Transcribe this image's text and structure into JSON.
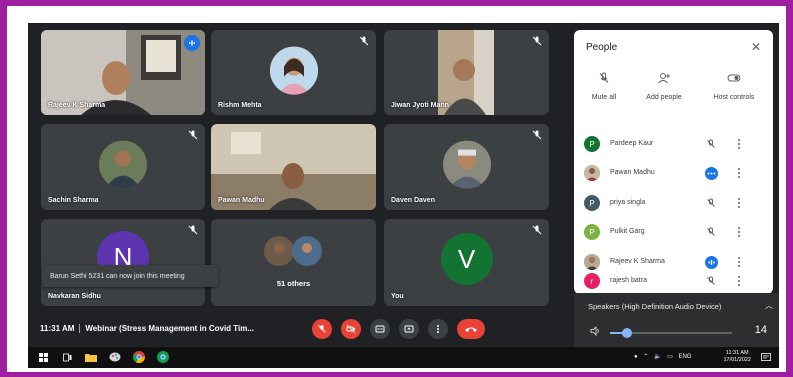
{
  "tiles": [
    {
      "name": "Rajeev K Sharma",
      "type": "video"
    },
    {
      "name": "Rishm Mehta",
      "type": "photo"
    },
    {
      "name": "Jiwan Jyoti Mann",
      "type": "video"
    },
    {
      "name": "Sachin Sharma",
      "type": "photo"
    },
    {
      "name": "Pawan Madhu",
      "type": "video"
    },
    {
      "name": "Daven Daven",
      "type": "photo"
    },
    {
      "name": "Navkaran Sidhu",
      "type": "letter",
      "letter": "N",
      "color": "#5e35b1"
    },
    {
      "name": "51 others",
      "type": "group"
    },
    {
      "name": "You",
      "type": "letter",
      "letter": "V",
      "color": "#137333"
    }
  ],
  "toast": "Barun Sethi 5231 can now join this meeting",
  "meeting": {
    "time": "11:31 AM",
    "title": "Webinar (Stress Management in Covid Tim..."
  },
  "panel": {
    "title": "People",
    "actions": [
      {
        "label": "Mute all",
        "icon": "mic-off-icon"
      },
      {
        "label": "Add people",
        "icon": "person-add-icon"
      },
      {
        "label": "Host controls",
        "icon": "toggle-icon"
      }
    ],
    "participants": [
      {
        "name": "Pardeep Kaur",
        "initial": "P",
        "color": "#137333",
        "status": "muted"
      },
      {
        "name": "Pawan Madhu",
        "initial": "",
        "color": "#8d6e63",
        "status": "more"
      },
      {
        "name": "priya singla",
        "initial": "P",
        "color": "#455a64",
        "status": "muted"
      },
      {
        "name": "Pulkit Garg",
        "initial": "P",
        "color": "#7cb342",
        "status": "muted"
      },
      {
        "name": "Rajeev K Sharma",
        "initial": "",
        "color": "#a1887f",
        "status": "speaking"
      },
      {
        "name": "rajesh batra",
        "initial": "r",
        "color": "#e91e63",
        "status": "muted"
      }
    ]
  },
  "audio": {
    "device": "Speakers (High Definition Audio Device)",
    "volume": "14",
    "level": 0.14
  },
  "taskbar": {
    "lang": "ENG",
    "time": "11:31 AM",
    "date": "17/01/2022"
  }
}
